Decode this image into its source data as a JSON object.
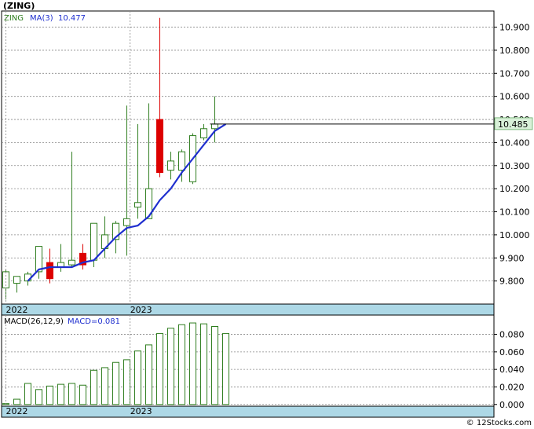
{
  "title": "(ZING)",
  "footer": "© 12Stocks.com",
  "colors": {
    "up": "#2e7d1e",
    "down": "#dd0000",
    "ma": "#1f2fcf",
    "grid": "#888888",
    "axis_band": "#add8e6",
    "last_price_bg": "#d8f0d8",
    "macd_bar": "#2e7d1e",
    "ma_short": "#e05a00"
  },
  "chart_data": [
    {
      "type": "candlestick",
      "name": "price",
      "legend": {
        "symbol": "ZING",
        "ma_label": "MA(3)",
        "ma_value": "10.477"
      },
      "last_price_label": "10.485",
      "ylim": [
        9.7,
        10.97
      ],
      "y_ticks": [
        "9.800",
        "9.900",
        "10.000",
        "10.100",
        "10.200",
        "10.300",
        "10.400",
        "10.500",
        "10.600",
        "10.700",
        "10.800",
        "10.900"
      ],
      "x_tick_labels": [
        {
          "label": "2022",
          "index": 0
        },
        {
          "label": "2023",
          "index": 11.3
        }
      ],
      "candles": [
        {
          "o": 9.77,
          "h": 9.85,
          "l": 9.72,
          "c": 9.84
        },
        {
          "o": 9.79,
          "h": 9.82,
          "l": 9.75,
          "c": 9.82
        },
        {
          "o": 9.8,
          "h": 9.84,
          "l": 9.78,
          "c": 9.83
        },
        {
          "o": 9.84,
          "h": 9.95,
          "l": 9.81,
          "c": 9.95
        },
        {
          "o": 9.88,
          "h": 9.94,
          "l": 9.79,
          "c": 9.81
        },
        {
          "o": 9.86,
          "h": 9.96,
          "l": 9.84,
          "c": 9.88
        },
        {
          "o": 9.87,
          "h": 10.36,
          "l": 9.86,
          "c": 9.89
        },
        {
          "o": 9.92,
          "h": 9.96,
          "l": 9.85,
          "c": 9.87
        },
        {
          "o": 9.89,
          "h": 10.05,
          "l": 9.86,
          "c": 10.05
        },
        {
          "o": 9.94,
          "h": 10.08,
          "l": 9.9,
          "c": 10.0
        },
        {
          "o": 9.98,
          "h": 10.06,
          "l": 9.92,
          "c": 10.05
        },
        {
          "o": 10.04,
          "h": 10.56,
          "l": 9.91,
          "c": 10.07
        },
        {
          "o": 10.12,
          "h": 10.48,
          "l": 10.07,
          "c": 10.14
        },
        {
          "o": 10.07,
          "h": 10.57,
          "l": 10.07,
          "c": 10.2
        },
        {
          "o": 10.5,
          "h": 10.94,
          "l": 10.25,
          "c": 10.27
        },
        {
          "o": 10.28,
          "h": 10.36,
          "l": 10.24,
          "c": 10.32
        },
        {
          "o": 10.28,
          "h": 10.37,
          "l": 10.23,
          "c": 10.36
        },
        {
          "o": 10.23,
          "h": 10.44,
          "l": 10.22,
          "c": 10.43
        },
        {
          "o": 10.42,
          "h": 10.48,
          "l": 10.41,
          "c": 10.46
        },
        {
          "o": 10.46,
          "h": 10.6,
          "l": 10.4,
          "c": 10.48
        }
      ],
      "ma_start": 2,
      "ma": [
        9.8,
        9.85,
        9.86,
        9.86,
        9.86,
        9.88,
        9.89,
        9.94,
        9.99,
        10.03,
        10.04,
        10.08,
        10.15,
        10.2,
        10.27,
        10.33,
        10.39,
        10.45,
        10.48
      ]
    },
    {
      "type": "bar",
      "name": "macd",
      "legend": {
        "label": "MACD(26,12,9)",
        "value_label": "MACD=0.081"
      },
      "ylim": [
        -0.002,
        0.102
      ],
      "y_ticks": [
        "0.000",
        "0.020",
        "0.040",
        "0.060",
        "0.080"
      ],
      "x_tick_labels": [
        {
          "label": "2022",
          "index": 0
        },
        {
          "label": "2023",
          "index": 11.3
        }
      ],
      "values": [
        0.001,
        0.006,
        0.024,
        0.017,
        0.021,
        0.023,
        0.024,
        0.022,
        0.039,
        0.042,
        0.048,
        0.051,
        0.061,
        0.068,
        0.081,
        0.087,
        0.091,
        0.093,
        0.092,
        0.089,
        0.081
      ]
    }
  ]
}
